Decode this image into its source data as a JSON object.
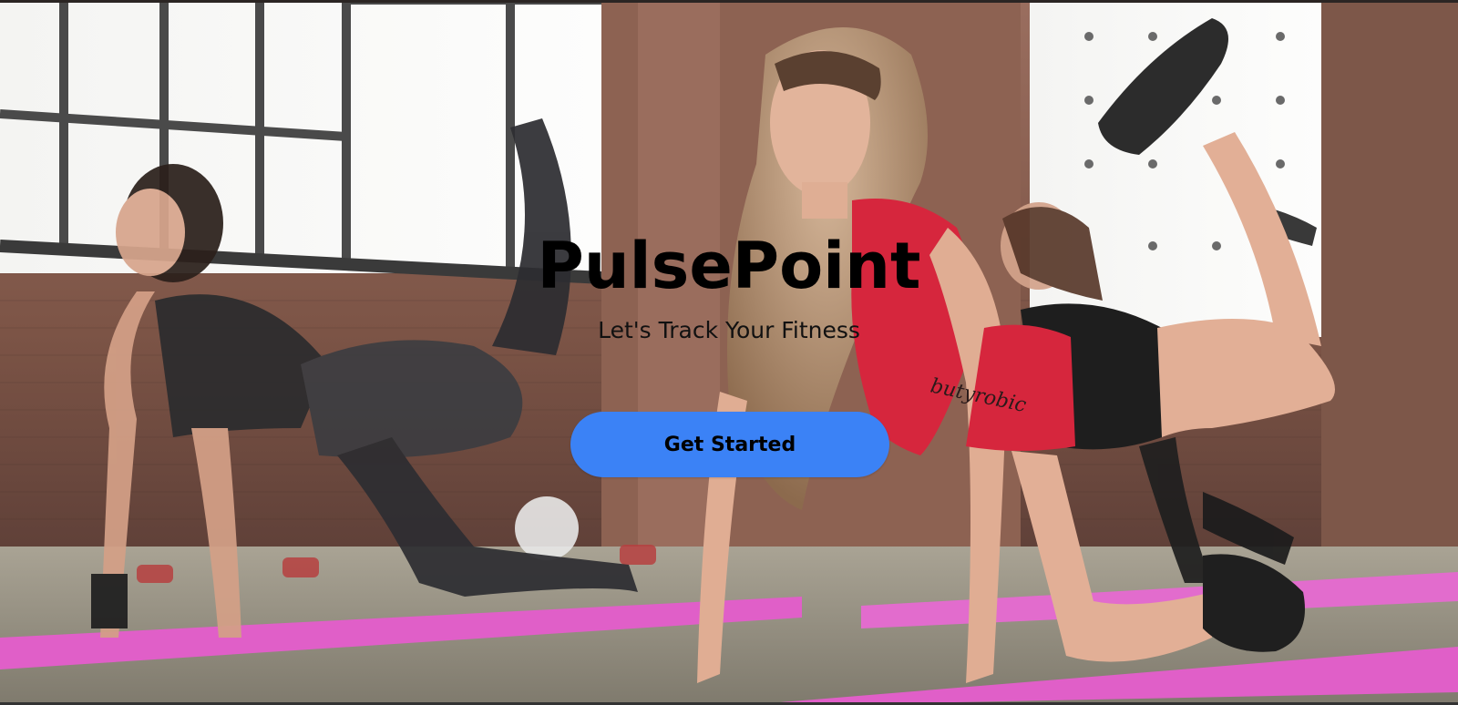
{
  "hero": {
    "title": "PulsePoint",
    "subtitle": "Let's Track Your Fitness",
    "cta_label": "Get Started",
    "background_image": "fitness-class-photo"
  },
  "colors": {
    "cta_background": "#3b82f6",
    "title_text": "#000000",
    "subtitle_text": "#111111",
    "yoga_mat": "#e05fc8",
    "brick_wall": "#8a5a4a"
  }
}
